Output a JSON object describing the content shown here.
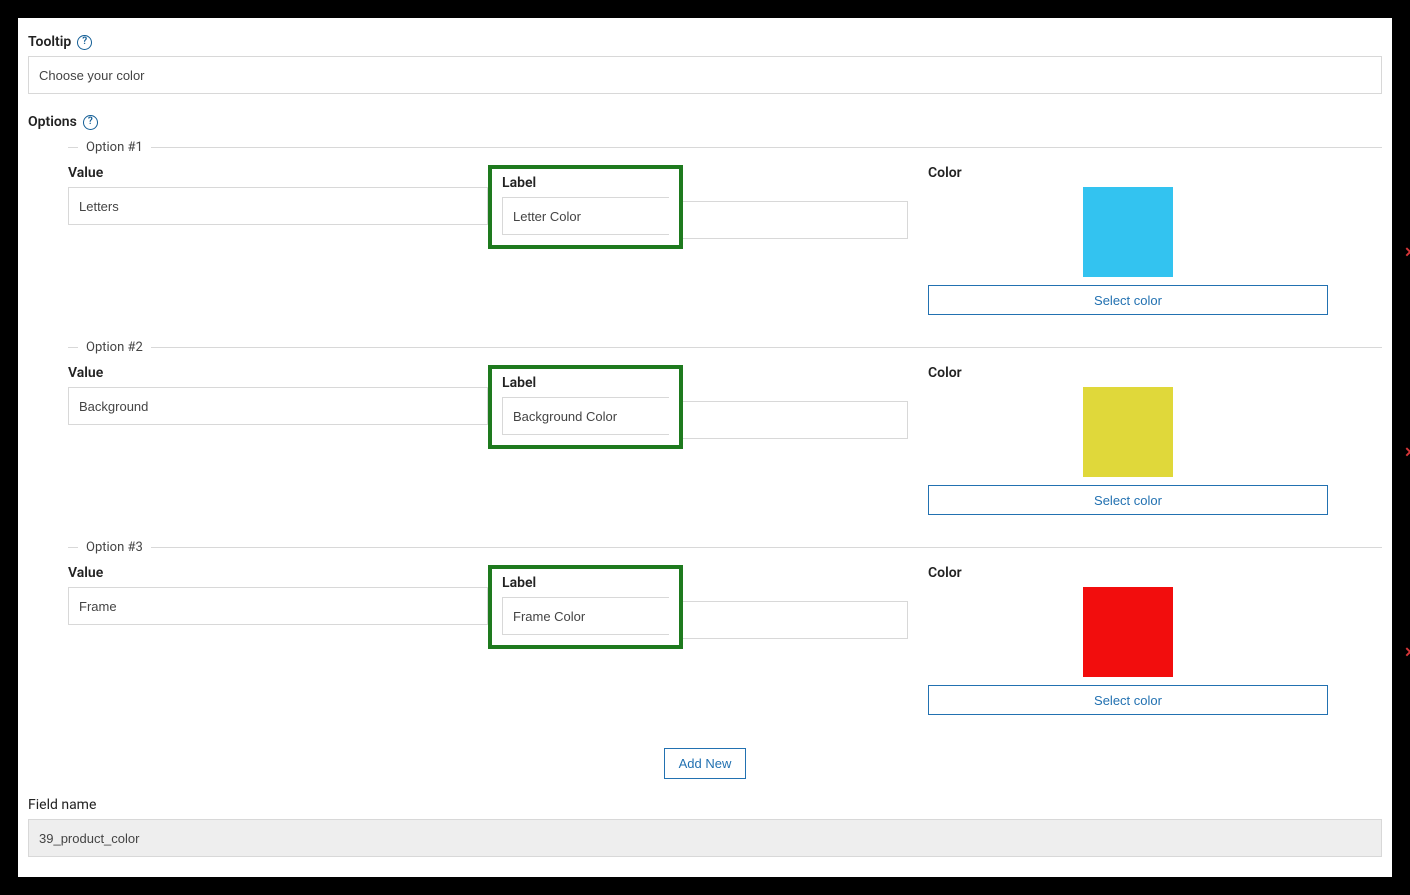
{
  "tooltip": {
    "label": "Tooltip",
    "value": "Choose your color"
  },
  "optionsHeader": "Options",
  "columns": {
    "value": "Value",
    "label": "Label",
    "color": "Color"
  },
  "options": [
    {
      "legend": "Option #1",
      "value": "Letters",
      "label": "Letter Color",
      "swatch": "#33c3f0",
      "selectLabel": "Select color"
    },
    {
      "legend": "Option #2",
      "value": "Background",
      "label": "Background Color",
      "swatch": "#e0d83a",
      "selectLabel": "Select color"
    },
    {
      "legend": "Option #3",
      "value": "Frame",
      "label": "Frame Color",
      "swatch": "#f20d0d",
      "selectLabel": "Select color"
    }
  ],
  "addNew": "Add New",
  "removeIcon": "✕",
  "fieldName": {
    "label": "Field name",
    "value": "39_product_color"
  }
}
